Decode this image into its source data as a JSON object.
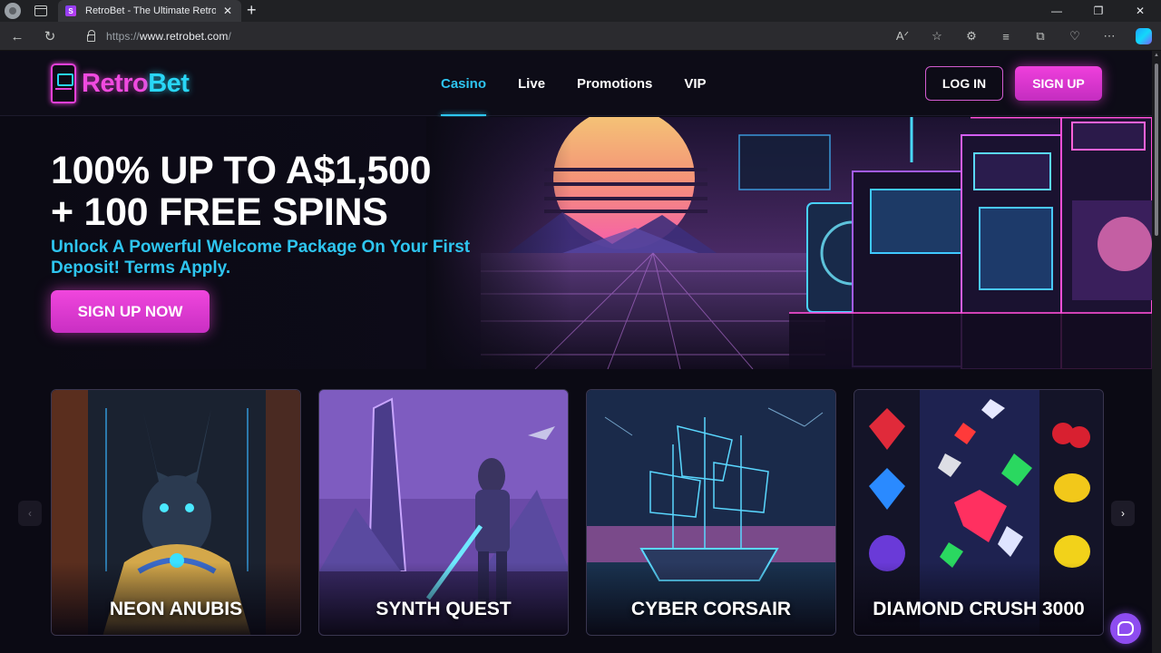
{
  "browser": {
    "tab_title": "RetroBet - The Ultimate Retro C",
    "tab_favicon_letter": "S",
    "url_prefix": "https://",
    "url_host": "www.retrobet.com",
    "url_suffix": "/"
  },
  "site": {
    "logo_part1": "Retro",
    "logo_part2": "Bet",
    "nav": [
      {
        "label": "Casino",
        "active": true
      },
      {
        "label": "Live",
        "active": false
      },
      {
        "label": "Promotions",
        "active": false
      },
      {
        "label": "VIP",
        "active": false
      }
    ],
    "login_label": "LOG IN",
    "signup_label": "SIGN UP"
  },
  "hero": {
    "headline_line1": "100% UP TO A$1,500",
    "headline_line2": "+ 100 FREE SPINS",
    "subtext": "Unlock A Powerful Welcome Package On Your First Deposit! Terms Apply.",
    "cta_label": "SIGN UP NOW"
  },
  "games": [
    {
      "name": "NEON ANUBIS"
    },
    {
      "name": "SYNTH QUEST"
    },
    {
      "name": "CYBER CORSAIR"
    },
    {
      "name": "DIAMOND CRUSH 3000"
    }
  ],
  "colors": {
    "accent_pink": "#ef3fdc",
    "accent_cyan": "#2ec5f0",
    "background": "#0b0a14"
  },
  "icons": {
    "back": "arrow-left-icon",
    "reload": "reload-icon",
    "chat": "chat-bubble-icon",
    "carousel_prev": "chevron-left-icon",
    "carousel_next": "chevron-right-icon"
  }
}
